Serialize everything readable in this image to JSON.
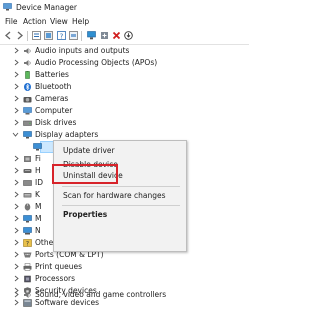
{
  "window": {
    "title": "Device Manager"
  },
  "menu": [
    "File",
    "Action",
    "View",
    "Help"
  ],
  "toolbar": [
    "back-icon",
    "forward-icon",
    "properties-icon",
    "show-hidden-icon",
    "help-icon",
    "update-driver-icon",
    "monitor-icon",
    "add-legacy-icon",
    "uninstall-icon",
    "scan-icon"
  ],
  "tree": {
    "items": [
      {
        "label": "Audio inputs and outputs",
        "icon": "audio-icon",
        "expanded": false
      },
      {
        "label": "Audio Processing Objects (APOs)",
        "icon": "audio-processing-icon",
        "expanded": false
      },
      {
        "label": "Batteries",
        "icon": "battery-icon",
        "expanded": false
      },
      {
        "label": "Bluetooth",
        "icon": "bluetooth-icon",
        "expanded": false
      },
      {
        "label": "Cameras",
        "icon": "camera-icon",
        "expanded": false
      },
      {
        "label": "Computer",
        "icon": "computer-icon",
        "expanded": false
      },
      {
        "label": "Disk drives",
        "icon": "disk-drive-icon",
        "expanded": false
      },
      {
        "label": "Display adapters",
        "icon": "display-adapter-icon",
        "expanded": true
      },
      {
        "label": "",
        "icon": "display-device-icon",
        "child": true,
        "selected": true
      },
      {
        "label": "Fi",
        "icon": "firmware-icon",
        "expanded": false
      },
      {
        "label": "H",
        "icon": "human-interface-icon",
        "expanded": false
      },
      {
        "label": "ID",
        "icon": "ide-icon",
        "expanded": false
      },
      {
        "label": "K",
        "icon": "keyboard-icon",
        "expanded": false
      },
      {
        "label": "M",
        "icon": "mouse-icon",
        "expanded": false
      },
      {
        "label": "M",
        "icon": "monitor-device-icon",
        "expanded": false
      },
      {
        "label": "N",
        "icon": "network-adapter-icon",
        "expanded": false
      },
      {
        "label": "Other devices",
        "icon": "other-devices-icon",
        "expanded": false
      },
      {
        "label": "Ports (COM & LPT)",
        "icon": "ports-icon",
        "expanded": false
      },
      {
        "label": "Print queues",
        "icon": "printer-icon",
        "expanded": false
      },
      {
        "label": "Processors",
        "icon": "processor-icon",
        "expanded": false
      },
      {
        "label": "Security devices",
        "icon": "security-icon",
        "expanded": false
      },
      {
        "label": "Software devices",
        "icon": "software-icon",
        "expanded": false
      },
      {
        "label": "Sound, video and game controllers",
        "icon": "sound-icon",
        "expanded": false
      }
    ]
  },
  "context_menu": {
    "items": [
      "Update driver",
      "Disable device",
      "Uninstall device",
      "Scan for hardware changes",
      "Properties"
    ],
    "highlighted": "Uninstall device",
    "highlight_color": "#d7232a"
  },
  "colors": {
    "selection": "#cce8ff",
    "accent": "#2f6fb3"
  }
}
